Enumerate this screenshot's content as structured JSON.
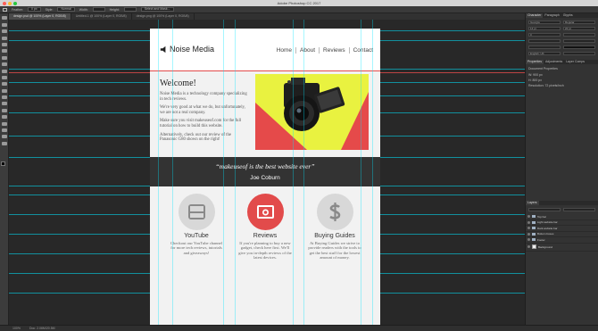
{
  "app": {
    "window_title": "Adobe Photoshop CC 2017",
    "traffic_lights": [
      "#ff5f57",
      "#febc2e",
      "#28c840"
    ]
  },
  "options_bar": {
    "feather_label": "Feather:",
    "feather_value": "0 px",
    "style_label": "Style:",
    "style_value": "Normal",
    "width_label": "Width:",
    "height_label": "Height:",
    "refine_label": "Select and Mask..."
  },
  "tabs": [
    {
      "label": "design.psd @ 100% (Layer 0, RGB/8)"
    },
    {
      "label": "Untitled-1 @ 100% (Layer 0, RGB/8)"
    },
    {
      "label": "design.png @ 100% (Layer 0, RGB/8)"
    }
  ],
  "site": {
    "brand": "Noise Media",
    "nav": [
      "Home",
      "About",
      "Reviews",
      "Contact"
    ],
    "welcome_heading": "Welcome!",
    "welcome_paragraphs": [
      "Noise Media is a technology company specializing in tech reviews.",
      "We're very good at what we do, but unfortunately, we are not a real company.",
      "Make sure you visit makeuseof.com for the full tutorial on how to build this website.",
      "Alternatively, check out our review of the Panasonic G80 shown on the right!"
    ],
    "quote": "“makeuseof is the best website ever”",
    "quote_author": "Joe Coburn",
    "cards": [
      {
        "title": "YouTube",
        "desc": "Checkout our YouTube channel for more tech reviews, tutorials and giveaways!",
        "icon": "youtube-icon",
        "color": "#d8d8d8",
        "glyph_color": "#8a8a8a"
      },
      {
        "title": "Reviews",
        "desc": "If you're planning to buy a new gadget, check here first. We'll give you in-depth reviews of the latest devices.",
        "icon": "camera-icon",
        "color": "#e24b4b",
        "glyph_color": "#ffffff"
      },
      {
        "title": "Buying Guides",
        "desc": "At Buying Guides we strive to provide readers with the tools to get the best stuff for the lowest amount of money.",
        "icon": "dollar-icon",
        "color": "#d8d8d8",
        "glyph_color": "#8a8a8a"
      }
    ]
  },
  "panels": {
    "character_tabs": [
      "Character",
      "Paragraph",
      "Glyphs"
    ],
    "font_family": "Georgia",
    "font_style": "Regular",
    "font_size": "14 pt",
    "leading": "22 pt",
    "tracking": "0",
    "language": "English: UK",
    "properties_tabs": [
      "Properties",
      "Adjustments",
      "Layer Comps"
    ],
    "properties_title": "Document Properties",
    "doc_width": "W: 900 px",
    "doc_height": "H: 800 px",
    "resolution": "Resolution: 72 pixels/inch",
    "layers_title": "Layers",
    "layers": [
      {
        "name": "Top bar",
        "type": "folder"
      },
      {
        "name": "Light website bar",
        "type": "folder"
      },
      {
        "name": "Dark website bar",
        "type": "folder"
      },
      {
        "name": "Bottom boxes",
        "type": "folder"
      },
      {
        "name": "Footer",
        "type": "folder"
      },
      {
        "name": "Background",
        "type": "layer"
      }
    ]
  },
  "status": {
    "zoom": "100%",
    "doc_size": "Doc: 2.06M/20.5M"
  }
}
